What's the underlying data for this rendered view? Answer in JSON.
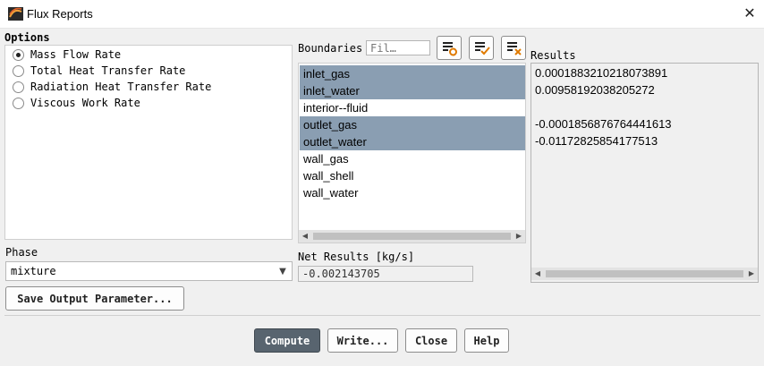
{
  "window": {
    "title": "Flux Reports"
  },
  "options": {
    "title": "Options",
    "items": [
      {
        "label": "Mass Flow Rate",
        "selected": true
      },
      {
        "label": "Total Heat Transfer Rate",
        "selected": false
      },
      {
        "label": "Radiation Heat Transfer Rate",
        "selected": false
      },
      {
        "label": "Viscous Work Rate",
        "selected": false
      }
    ]
  },
  "phase": {
    "label": "Phase",
    "value": "mixture"
  },
  "save_button": "Save Output Parameter...",
  "boundaries": {
    "label": "Boundaries",
    "filter_placeholder": "Fil…",
    "items": [
      {
        "label": "inlet_gas",
        "selected": true
      },
      {
        "label": "inlet_water",
        "selected": true
      },
      {
        "label": "interior--fluid",
        "selected": false
      },
      {
        "label": "outlet_gas",
        "selected": true
      },
      {
        "label": "outlet_water",
        "selected": true
      },
      {
        "label": "wall_gas",
        "selected": false
      },
      {
        "label": "wall_shell",
        "selected": false
      },
      {
        "label": "wall_water",
        "selected": false
      }
    ]
  },
  "net_results": {
    "label": "Net Results [kg/s]",
    "value": "-0.002143705"
  },
  "results": {
    "label": "Results",
    "lines": [
      "0.0001883210218073891",
      "0.00958192038205272",
      "",
      "-0.0001856876764441613",
      "-0.01172825854177513"
    ]
  },
  "buttons": {
    "compute": "Compute",
    "write": "Write...",
    "close": "Close",
    "help": "Help"
  }
}
